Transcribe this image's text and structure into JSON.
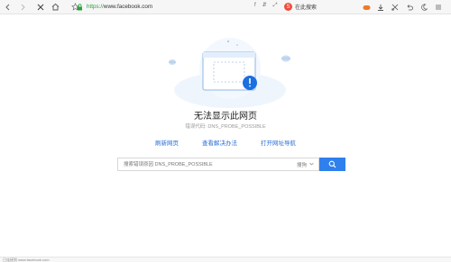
{
  "toolbar": {
    "url_protocol": "https://",
    "url_host": "www.facebook.com",
    "url_tools": [
      "f",
      "⇵",
      "⤢",
      "⌄"
    ],
    "search_engine_badge": "S",
    "search_placeholder": "在此搜索"
  },
  "error_page": {
    "title": "无法显示此网页",
    "error_code": "错误代码: DNS_PROBE_POSSIBLE",
    "links": [
      "刷新网页",
      "查看解决办法",
      "打开网址导航"
    ],
    "search": {
      "placeholder": "搜索错误原因 DNS_PROBE_POSSIBLE",
      "engine": "搜狗"
    }
  },
  "statusbar": {
    "text": "已连接到 www.facebook.com"
  },
  "colors": {
    "accent": "#2f80ed",
    "link": "#2a6fd6",
    "secure": "#2aa13a",
    "alert": "#1b6fe0"
  },
  "icons": {
    "back": "chevron-left-icon",
    "forward": "chevron-right-icon",
    "stop": "close-icon",
    "home": "home-icon",
    "bookmark": "star-icon",
    "lock": "lock-icon",
    "search_button": "search-icon"
  }
}
